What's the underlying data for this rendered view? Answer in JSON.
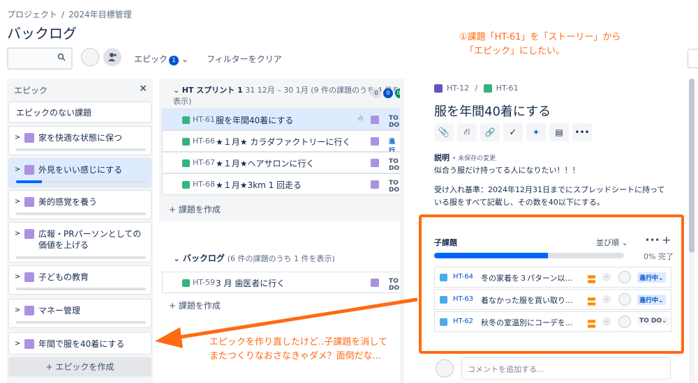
{
  "breadcrumb": {
    "project": "プロジェクト",
    "sep": "/",
    "board": "2024年目標管理"
  },
  "page_title": "バックログ",
  "toolbar": {
    "search_placeholder": "",
    "epic_label": "エピック",
    "epic_count": "1",
    "clear_filter": "フィルターをクリア"
  },
  "epic_panel": {
    "title": "エピック",
    "close": "×",
    "no_epic": "エピックのない課題",
    "epics": [
      {
        "label": "家を快適な状態に保つ",
        "progress": 0
      },
      {
        "label": "外見をいい感じにする",
        "progress": 0.2
      },
      {
        "label": "美的感覚を養う",
        "progress": 0
      },
      {
        "label": "広報・PRパーソンとしての価値を上げる",
        "progress": 0
      },
      {
        "label": "子どもの教育",
        "progress": 0
      },
      {
        "label": "マネー管理",
        "progress": 0
      },
      {
        "label": "年間で服を40着にする",
        "progress": 0
      }
    ],
    "create": "+ エピックを作成"
  },
  "sprint": {
    "name": "HT スプリント 1",
    "dates": "31 12月 – 30 1月",
    "count": "(9 件の課題のうち 4 件を表示)",
    "badges": [
      "0",
      "0",
      "0"
    ],
    "issues": [
      {
        "key": "HT-61",
        "summary": "服を年間40着にする",
        "status": "TO DO"
      },
      {
        "key": "HT-66",
        "summary": "★１月★ カラダファクトリーに行く",
        "status": "進行中"
      },
      {
        "key": "HT-67",
        "summary": "★１月★ヘアサロンに行く",
        "status": "TO DO"
      },
      {
        "key": "HT-68",
        "summary": "★１月★3km 1 回走る",
        "status": "TO DO"
      }
    ],
    "create": "+ 課題を作成"
  },
  "backlog": {
    "name": "バックログ",
    "count": "(6 件の課題のうち 1 件を表示)",
    "issues": [
      {
        "key": "HT-59",
        "summary": "3 月 歯医者に行く",
        "status": "TO DO"
      }
    ],
    "create": "+ 課題を作成"
  },
  "detail": {
    "parent_key": "HT-12",
    "sep": "/",
    "key": "HT-61",
    "title": "服を年間40着にする",
    "desc_label": "説明",
    "unsaved": "• 未保存の変更",
    "desc_line1": "似合う服だけ持ってる人になりたい！！！",
    "desc_line2": "受け入れ基準：2024年12月31日までにスプレッドシートに持って",
    "desc_line3": "いる服をすべて記載し、その数を40以下にする。",
    "subtasks_title": "子課題",
    "sort": "並び順",
    "progress_text": "0% 完了",
    "progress": 0.6,
    "subtasks": [
      {
        "key": "HT-64",
        "summary": "冬の家着を３パターン以...",
        "priority": "〓",
        "dash": "-",
        "status": "進行中"
      },
      {
        "key": "HT-63",
        "summary": "着なかった服を買い取り...",
        "priority": "〓",
        "dash": "-",
        "status": "進行中"
      },
      {
        "key": "HT-62",
        "summary": "秋冬の室温別にコーデを...",
        "priority": "〓",
        "dash": "-",
        "status": "TO DO"
      }
    ],
    "comment_placeholder": "コメントを追加する..."
  },
  "annotations": {
    "note1_line1": "①課題「HT-61」を「ストーリー」から",
    "note1_line2": "「エピック」にしたい。",
    "note2_line1": "エピックを作り直したけど..子課題を消して",
    "note2_line2": "またつくりなおさなきゃダメ？面倒だな...",
    "color": "#ff6a13"
  }
}
